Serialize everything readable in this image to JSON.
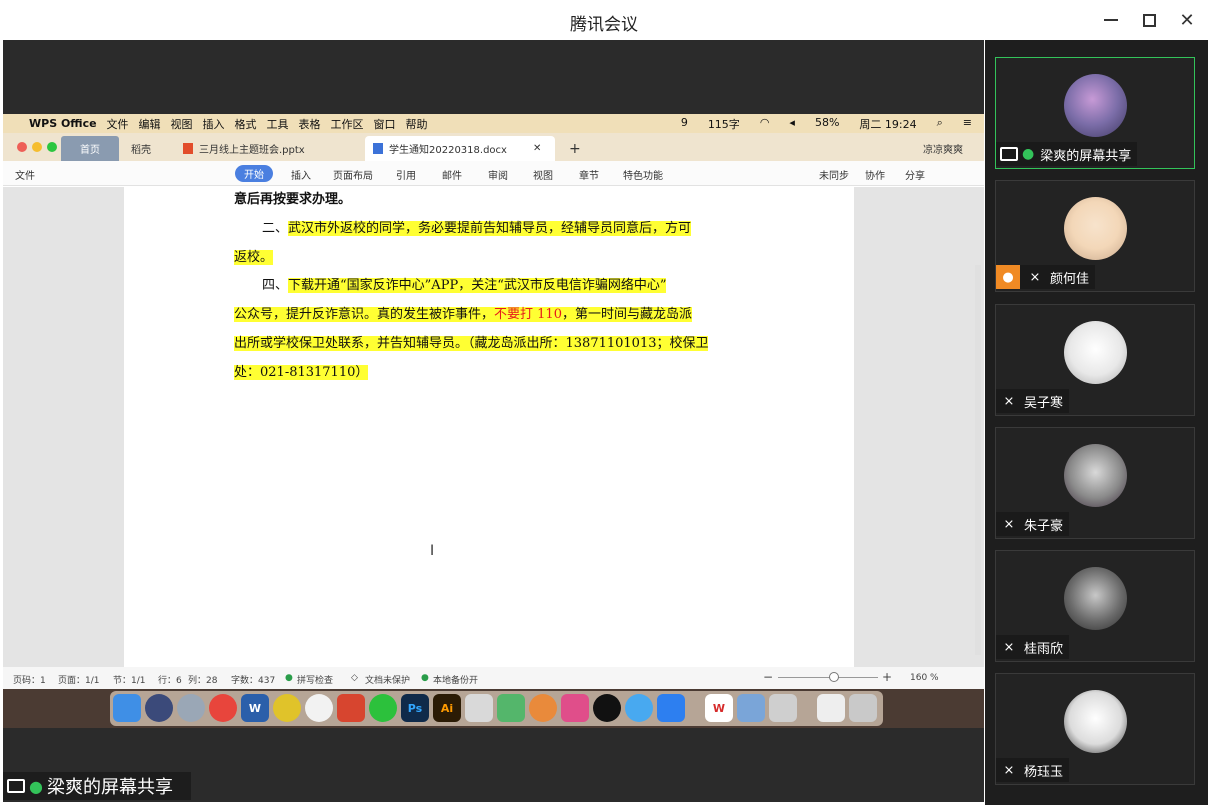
{
  "window": {
    "title": "腾讯会议"
  },
  "mac_menu": {
    "app_name": "WPS Office",
    "items": [
      "文件",
      "编辑",
      "视图",
      "插入",
      "格式",
      "工具",
      "表格",
      "工作区",
      "窗口",
      "帮助"
    ],
    "status": {
      "num": "9",
      "speed": "115字",
      "battery": "58%",
      "clock": "周二 19:24"
    }
  },
  "wps_tabs": {
    "home": "首页",
    "straw": "稻壳",
    "tab1": "三月线上主题班会.pptx",
    "tab2": "学生通知20220318.docx",
    "user": "凉凉爽爽"
  },
  "wps_toolbar": {
    "file": "文件",
    "items": [
      "开始",
      "插入",
      "页面布局",
      "引用",
      "邮件",
      "审阅",
      "视图",
      "章节",
      "特色功能"
    ],
    "right": [
      "未同步",
      "协作",
      "分享"
    ]
  },
  "document": {
    "line1": "意后再按要求办理。",
    "line2_prefix": "二、",
    "line2": "武汉市外返校的同学，务必要提前告知辅导员，经辅导员同意后，方可",
    "line3": "返校。",
    "line4_prefix": "四、",
    "line4": "下载开通“国家反诈中心”APP，关注“武汉市反电信诈骗网络中心”",
    "line5a": "公众号，提升反诈意识。真的发生被诈事件，",
    "line5red": "不要打 110",
    "line5b": "，第一时间与藏龙岛派",
    "line6": "出所或学校保卫处联系，并告知辅导员。（藏龙岛派出所：13871101013；校保卫",
    "line7": "处：021-81317110）"
  },
  "status_bar": {
    "page": "页码：1",
    "pages": "页面：1/1",
    "section": "节：1/1",
    "row": "行：6",
    "col": "列：28",
    "words": "字数：437",
    "spell": "拼写检查",
    "protect": "文档未保护",
    "backup": "本地备份开",
    "zoom": "160 %"
  },
  "share_label": "梁爽的屏幕共享",
  "participants": [
    {
      "name": "梁爽的屏幕共享",
      "mic": "on",
      "sharing": true,
      "avatar_color": "#7b6da8"
    },
    {
      "name": "颜何佳",
      "mic": "off",
      "sharing": false,
      "avatar_color": "#f3d7b8"
    },
    {
      "name": "吴子寒",
      "mic": "off",
      "sharing": false,
      "avatar_color": "#e8e8e8"
    },
    {
      "name": "朱子豪",
      "mic": "off",
      "sharing": false,
      "avatar_color": "#8a8a8a"
    },
    {
      "name": "桂雨欣",
      "mic": "off",
      "sharing": false,
      "avatar_color": "#6b6b6b"
    },
    {
      "name": "杨珏玉",
      "mic": "off",
      "sharing": false,
      "avatar_color": "#dcdcdc"
    }
  ],
  "colors": {
    "accent": "#33c35a",
    "highlight": "#ffff33",
    "warning_red": "#e61b1b"
  }
}
